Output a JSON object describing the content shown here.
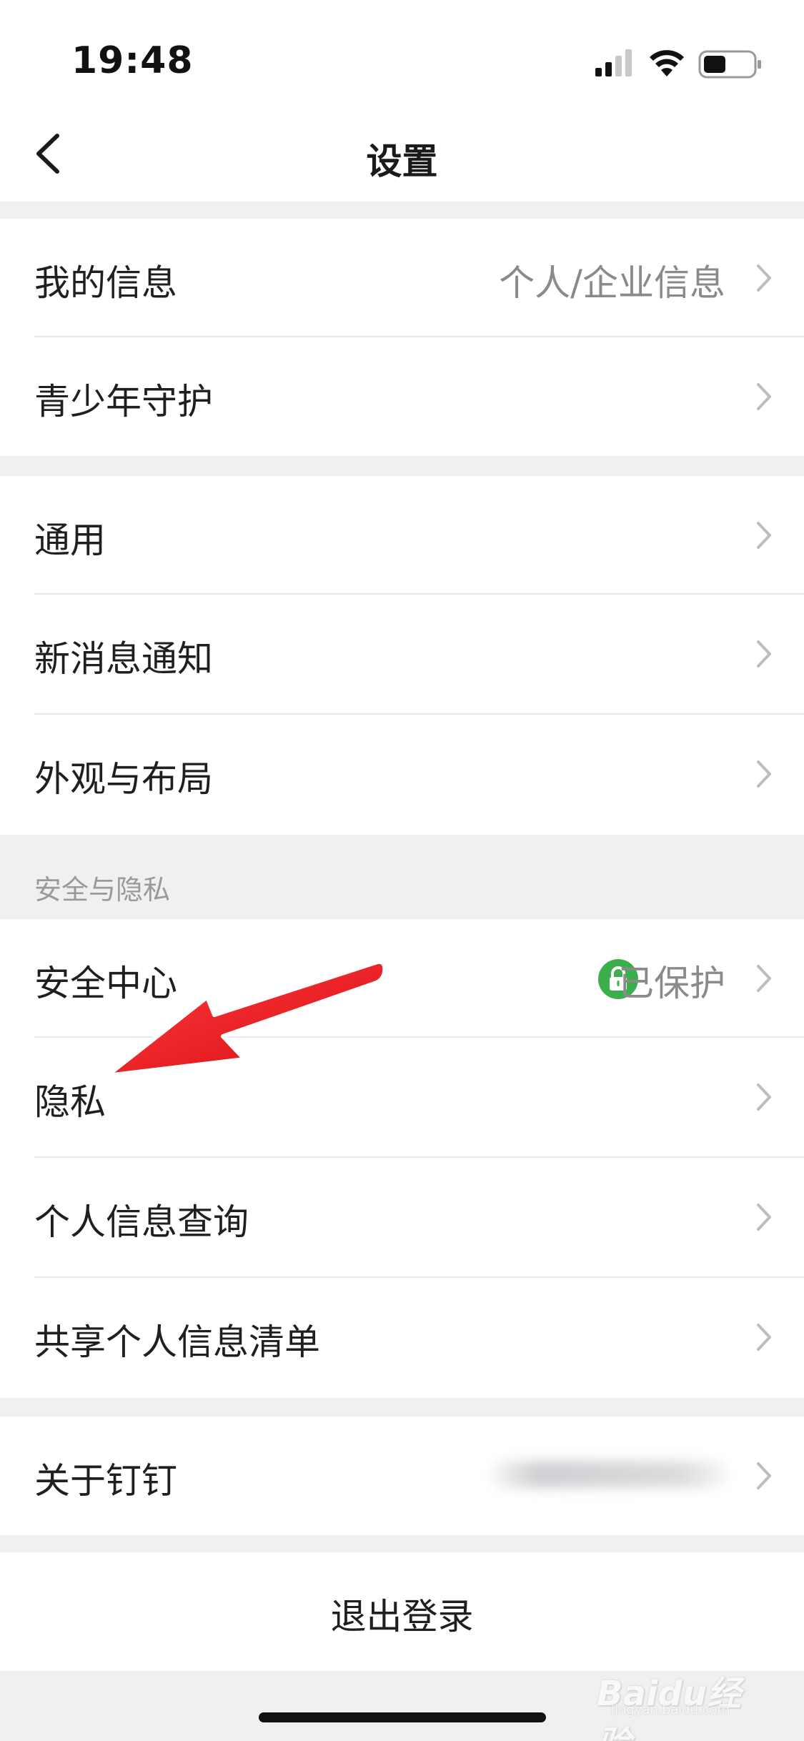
{
  "status_bar": {
    "time": "19:48",
    "icons": [
      "signal-icon",
      "wifi-icon",
      "battery-icon"
    ]
  },
  "nav": {
    "title": "设置",
    "back_icon": "chevron-left-icon"
  },
  "groups": [
    {
      "rows": [
        {
          "label": "我的信息",
          "value": "个人/企业信息"
        },
        {
          "label": "青少年守护",
          "value": ""
        }
      ]
    },
    {
      "rows": [
        {
          "label": "通用",
          "value": ""
        },
        {
          "label": "新消息通知",
          "value": ""
        },
        {
          "label": "外观与布局",
          "value": ""
        }
      ]
    },
    {
      "header": "安全与隐私",
      "rows": [
        {
          "label": "安全中心",
          "value": "已保护",
          "icon": "lock-icon"
        },
        {
          "label": "隐私",
          "value": ""
        },
        {
          "label": "个人信息查询",
          "value": ""
        },
        {
          "label": "共享个人信息清单",
          "value": ""
        }
      ]
    },
    {
      "rows": [
        {
          "label": "关于钉钉",
          "value": ""
        }
      ]
    }
  ],
  "logout": {
    "label": "退出登录"
  },
  "watermark": {
    "text": "Baidu经验",
    "sub": "jingyan.baidu.com"
  },
  "colors": {
    "background": "#f0f0f2",
    "surface": "#ffffff",
    "badge_green": "#3dae4c",
    "annotation_arrow": "#e8141b",
    "secondary_text": "#8a8a8a"
  }
}
